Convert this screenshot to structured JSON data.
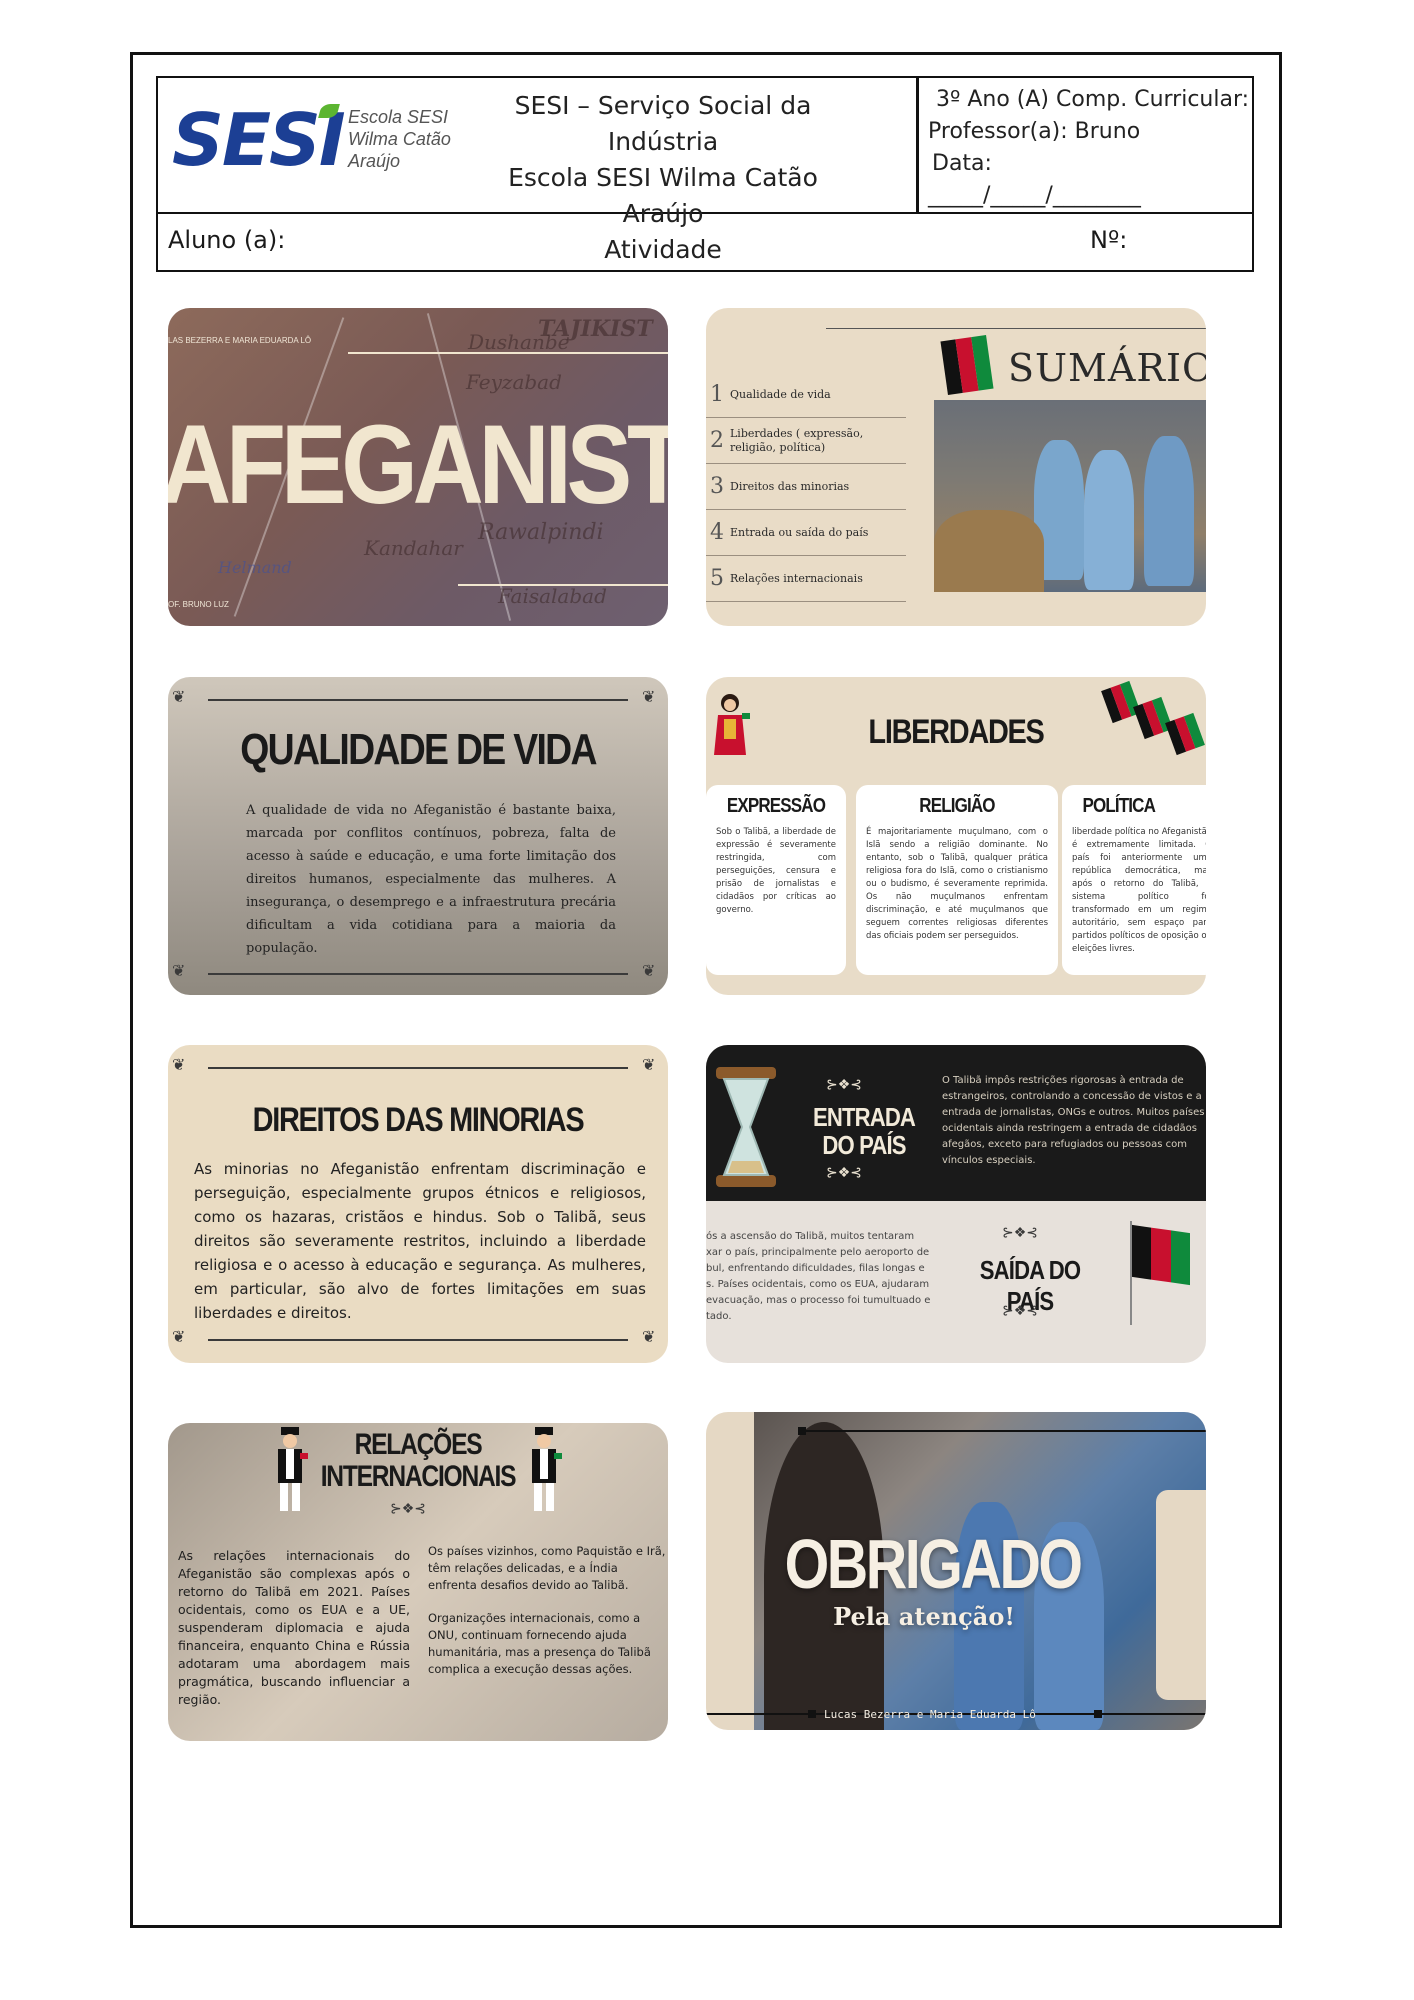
{
  "header": {
    "logo_text": "SESI",
    "logo_sub": [
      "Escola SESI",
      "Wilma Catão",
      "Araújo"
    ],
    "title_lines": [
      "SESI – Serviço Social da Indústria",
      "Escola SESI Wilma Catão Araújo",
      "Atividade"
    ],
    "class_label": "3º Ano (A) Comp. Curricular:",
    "teacher_label": "Professor(a): Bruno",
    "date_label": "Data:",
    "date_blank": "_____/_____/________",
    "student_label": "Aluno (a):",
    "number_label": "Nº:"
  },
  "slides": {
    "cover": {
      "title": "AFEGANISTÃO",
      "top_small": "LAS BEZERRA E MARIA EDUARDA LÔ",
      "bottom_small": "OF. BRUNO LUZ",
      "map_labels": [
        "Dushanbe",
        "TAJIKIST",
        "Feyzabad",
        "Rawalpindi",
        "Kandahar",
        "Faisalabad",
        "Helmand"
      ]
    },
    "summary": {
      "title": "SUMÁRIO",
      "items": [
        {
          "num": "1",
          "text": "Qualidade de vida"
        },
        {
          "num": "2",
          "text": "Liberdades ( expressão, religião, política)"
        },
        {
          "num": "3",
          "text": "Direitos das minorias"
        },
        {
          "num": "4",
          "text": "Entrada ou saída do país"
        },
        {
          "num": "5",
          "text": "Relações internacionais"
        }
      ]
    },
    "quality": {
      "title": "QUALIDADE DE VIDA",
      "body": "A qualidade de vida no Afeganistão é bastante baixa, marcada por conflitos contínuos, pobreza, falta de acesso à saúde e educação, e uma forte limitação dos direitos humanos, especialmente das mulheres. A insegurança, o desemprego e a infraestrutura precária dificultam a vida cotidiana para a maioria da população."
    },
    "freedoms": {
      "title": "LIBERDADES",
      "cards": [
        {
          "title": "EXPRESSÃO",
          "body": "Sob o Talibã, a liberdade de expressão é severamente restringida, com perseguições, censura e prisão de jornalistas e cidadãos por críticas ao governo."
        },
        {
          "title": "RELIGIÃO",
          "body": "É majoritariamente muçulmano, com o Islã sendo a religião dominante. No entanto, sob o Talibã, qualquer prática religiosa fora do Islã, como o cristianismo ou o budismo, é severamente reprimida. Os não muçulmanos enfrentam discriminação, e até muçulmanos que seguem correntes religiosas diferentes das oficiais podem ser perseguidos."
        },
        {
          "title": "POLÍTICA",
          "body": "liberdade política no Afeganistão é extremamente limitada. O país foi anteriormente uma república democrática, mas após o retorno do Talibã, o sistema político foi transformado em um regime autoritário, sem espaço para partidos políticos de oposição ou eleições livres."
        }
      ]
    },
    "minorities": {
      "title": "DIREITOS DAS MINORIAS",
      "body": "As minorias no Afeganistão enfrentam discriminação e perseguição, especialmente grupos étnicos e religiosos, como os hazaras, cristãos e hindus. Sob o Talibã, seus direitos são severamente restritos, incluindo a liberdade religiosa e o acesso à educação e segurança. As mulheres, em particular, são alvo de fortes limitações em suas liberdades e direitos."
    },
    "entry_exit": {
      "entry_title": "ENTRADA DO PAÍS",
      "entry_lines": [
        "O Talibã impôs restrições rigorosas à entrada de",
        "estrangeiros, controlando a concessão de vistos e a",
        "entrada de jornalistas, ONGs e outros. Muitos países",
        "ocidentais ainda restringem a entrada de cidadãos",
        "afegãos, exceto para refugiados ou pessoas com",
        "vínculos especiais."
      ],
      "exit_title": "SAÍDA DO PAÍS",
      "exit_lines": [
        "ós a ascensão do Talibã, muitos tentaram",
        "xar o país, principalmente pelo aeroporto de",
        "bul, enfrentando dificuldades, filas longas e",
        "s. Países ocidentais, como os EUA, ajudaram",
        "evacuação, mas o processo foi tumultuado e",
        "tado."
      ]
    },
    "international": {
      "title_lines": [
        "RELAÇÕES",
        "INTERNACIONAIS"
      ],
      "col1": "As relações internacionais do Afeganistão são complexas após o retorno do Talibã em 2021. Países ocidentais, como os EUA e a UE, suspenderam diplomacia e ajuda financeira, enquanto China e Rússia adotaram uma abordagem mais pragmática, buscando influenciar a região.",
      "col2_p1": "Os países vizinhos, como Paquistão e Irã, têm relações delicadas, e a Índia enfrenta desafios devido ao Talibã.",
      "col2_p2": "Organizações internacionais, como a ONU, continuam fornecendo ajuda humanitária, mas a presença do Talibã complica a execução dessas ações."
    },
    "thanks": {
      "title": "OBRIGADO",
      "subtitle": "Pela atenção!",
      "credits": "Lucas Bezerra e Maria Eduarda Lô"
    }
  },
  "colors": {
    "sesi_blue": "#1c3f94",
    "sesi_green": "#5cb531",
    "slide_beige": "#e9dcc7",
    "flag_black": "#111111",
    "flag_red": "#c8102e",
    "flag_green": "#0f8a3c"
  }
}
